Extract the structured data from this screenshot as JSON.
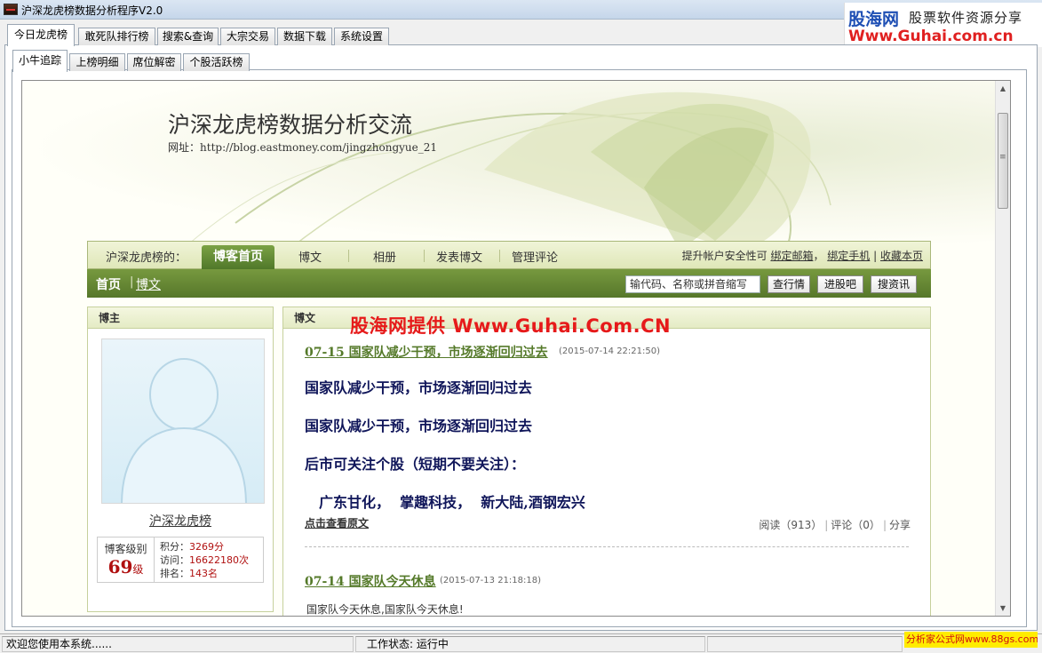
{
  "window": {
    "title": "沪深龙虎榜数据分析程序V2.0"
  },
  "brand": {
    "name": "股海网",
    "slogan": "股票软件资源分享",
    "url": "Www.Guhai.com.cn"
  },
  "main_tabs": [
    {
      "label": "今日龙虎榜",
      "active": true
    },
    {
      "label": "敢死队排行榜"
    },
    {
      "label": "搜索&查询"
    },
    {
      "label": "大宗交易"
    },
    {
      "label": "数据下载"
    },
    {
      "label": "系统设置"
    }
  ],
  "sub_tabs": [
    {
      "label": "小牛追踪",
      "active": true
    },
    {
      "label": "上榜明细"
    },
    {
      "label": "席位解密"
    },
    {
      "label": "个股活跃榜"
    }
  ],
  "blog": {
    "title": "沪深龙虎榜数据分析交流",
    "url_label": "网址：",
    "url": "http://blog.eastmoney.com/jingzhongyue_21"
  },
  "nav": {
    "owner_label": "沪深龙虎榜的：",
    "items": [
      "博客首页",
      "博文",
      "相册",
      "发表博文",
      "管理评论"
    ],
    "security_text": "提升帐户安全性可",
    "bind_email": "绑定邮箱",
    "bind_phone": "绑定手机",
    "bookmark": "收藏本页",
    "home": "首页",
    "sep": "|",
    "blog_link": "博文",
    "search_placeholder": "输代码、名称或拼音缩写",
    "buttons": [
      "查行情",
      "进股吧",
      "搜资讯"
    ]
  },
  "owner_box": {
    "heading": "博主",
    "name": "沪深龙虎榜",
    "level_label": "博客级别",
    "level": "69",
    "level_unit": "级",
    "stats": [
      {
        "label": "积分：",
        "value": "3269分"
      },
      {
        "label": "访问：",
        "value": "16622180次"
      },
      {
        "label": "排名：",
        "value": "143名"
      }
    ]
  },
  "posts_box": {
    "heading": "博文",
    "watermark": "股海网提供 Www.Guhai.Com.CN",
    "posts": [
      {
        "title": "07-15 国家队减少干预，市场逐渐回归过去",
        "time": "(2015-07-14 22:21:50)",
        "lines": [
          "国家队减少干预，市场逐渐回归过去",
          "国家队减少干预，市场逐渐回归过去",
          "后市可关注个股（短期不要关注）：",
          "广东甘化，  掌趣科技，  新大陆,酒钢宏兴"
        ],
        "read_more": "点击查看原文",
        "reads": "阅读（913）",
        "comments": "评论（0）",
        "share": "分享"
      },
      {
        "title": "07-14 国家队今天休息",
        "time": "(2015-07-13 21:18:18)",
        "body": "国家队今天休息,国家队今天休息!"
      }
    ]
  },
  "statusbar": {
    "welcome": "欢迎您使用本系统......",
    "state": "工作状态: 运行中",
    "stamp": "分析家公式网www.88gs.com"
  }
}
